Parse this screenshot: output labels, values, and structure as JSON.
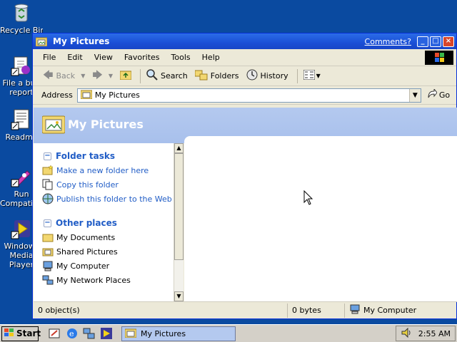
{
  "desktop": {
    "icons": [
      {
        "label": "Recycle Bin"
      },
      {
        "label": "File a bug report"
      },
      {
        "label": "Readme"
      },
      {
        "label": "Run Compatibility"
      },
      {
        "label": "Windows Media Player"
      }
    ]
  },
  "window": {
    "title": "My Pictures",
    "comments_link": "Comments?",
    "controls": {
      "minimize": "_",
      "maximize": "□",
      "close": "×"
    }
  },
  "menu": [
    "File",
    "Edit",
    "View",
    "Favorites",
    "Tools",
    "Help"
  ],
  "toolbar": {
    "back": "Back",
    "search": "Search",
    "folders": "Folders",
    "history": "History"
  },
  "address": {
    "label": "Address",
    "value": "My Pictures",
    "go": "Go"
  },
  "header": {
    "title": "My Pictures"
  },
  "folder_tasks": {
    "heading": "Folder tasks",
    "items": [
      "Make a new folder here",
      "Copy this folder",
      "Publish this folder to the Web"
    ]
  },
  "other_places": {
    "heading": "Other places",
    "items": [
      "My Documents",
      "Shared Pictures",
      "My Computer",
      "My Network Places"
    ]
  },
  "status": {
    "objects": "0 object(s)",
    "size": "0 bytes",
    "location": "My Computer"
  },
  "taskbar": {
    "start": "Start",
    "task": "My Pictures",
    "clock": "2:55 AM"
  }
}
